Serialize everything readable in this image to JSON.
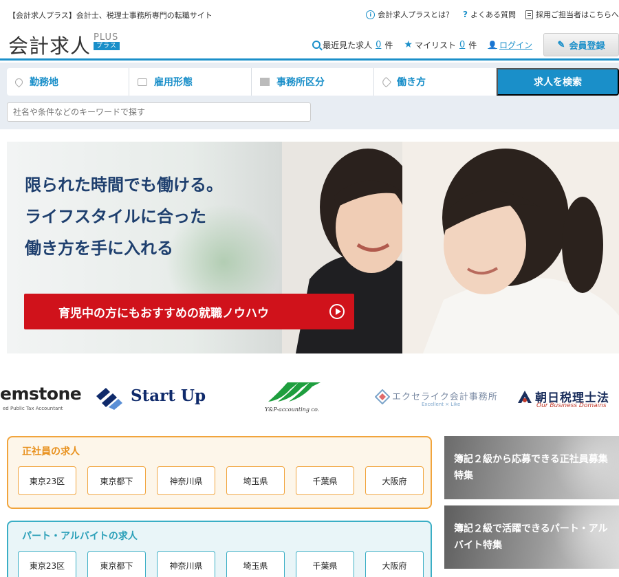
{
  "topbar": {
    "tagline": "【会計求人プラス】会計士、税理士事務所専門の転職サイト",
    "links": [
      {
        "icon": "info-icon",
        "label": "会計求人プラスとは？"
      },
      {
        "icon": "question-icon",
        "label": "よくある質問"
      },
      {
        "icon": "document-icon",
        "label": "採用ご担当者はこちらへ"
      }
    ]
  },
  "header": {
    "logo_main": "会計求人",
    "logo_plus": "PLUS",
    "logo_kana": "プラス",
    "recent_label": "最近見た求人",
    "recent_count": "0",
    "recent_unit": "件",
    "mylist_label": "マイリスト",
    "mylist_count": "0",
    "mylist_unit": "件",
    "login_label": "ログイン",
    "register_label": "会員登録"
  },
  "search": {
    "filters": [
      {
        "icon": "location-pin-icon",
        "label": "勤務地"
      },
      {
        "icon": "briefcase-icon",
        "label": "雇用形態"
      },
      {
        "icon": "building-icon",
        "label": "事務所区分"
      },
      {
        "icon": "tag-icon",
        "label": "働き方"
      }
    ],
    "button_label": "求人を検索",
    "keyword_placeholder": "社名や条件などのキーワードで探す"
  },
  "hero": {
    "line1": "限られた時間でも働ける。",
    "line2": "ライフスタイルに合った",
    "line3": "働き方を手に入れる",
    "cta": "育児中の方にもおすすめの就職ノウハウ"
  },
  "logos": {
    "gemstone": "emstone",
    "gemstone_sub": "ed Public Tax Accountant",
    "startup": "Start Up",
    "yp": "Y&P-accounting co.",
    "excelike": "エクセライク会計事務所",
    "excelike_sub": "Excellent × Like",
    "asahi": "朝日税理士法",
    "asahi_sub": "Our Business Domains"
  },
  "jobs": {
    "fulltime": {
      "title": "正社員の求人",
      "areas": [
        "東京23区",
        "東京都下",
        "神奈川県",
        "埼玉県",
        "千葉県",
        "大阪府"
      ]
    },
    "parttime": {
      "title": "パート・アルバイトの求人",
      "areas": [
        "東京23区",
        "東京都下",
        "神奈川県",
        "埼玉県",
        "千葉県",
        "大阪府"
      ]
    }
  },
  "side": {
    "banner1": "簿記２級から応募できる正社員募集特集",
    "banner2": "簿記２級で活躍できるパート・アルバイト特集"
  },
  "colors": {
    "brand": "#1a8fc9",
    "cta_red": "#d0121b",
    "fulltime_accent": "#f1a43c",
    "parttime_accent": "#3aaec5"
  }
}
